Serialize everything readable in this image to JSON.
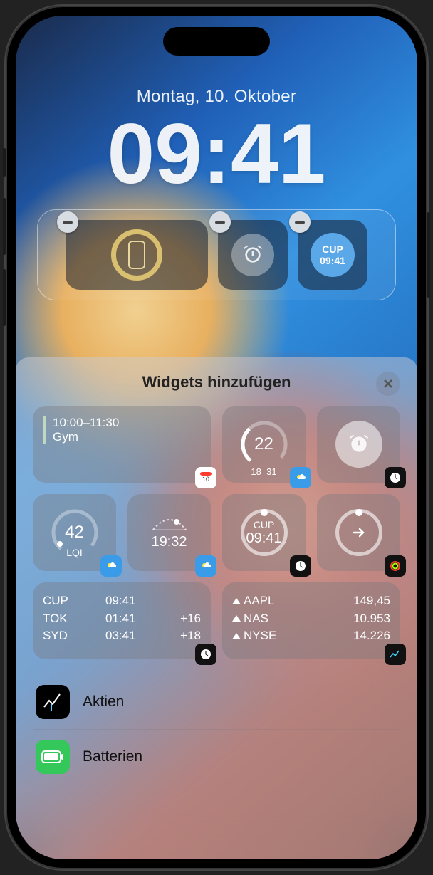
{
  "lock": {
    "date": "Montag, 10. Oktober",
    "time": "09:41",
    "slots": {
      "clock_city": "CUP",
      "clock_time": "09:41"
    }
  },
  "panel": {
    "title": "Widgets hinzufügen",
    "suggested": {
      "calendar": {
        "time": "10:00–11:30",
        "title": "Gym"
      },
      "weather_ring": {
        "value": "22",
        "low": "18",
        "high": "31"
      },
      "aqi": {
        "value": "42",
        "label": "LQI"
      },
      "sunset": {
        "time": "19:32"
      },
      "cup_clock": {
        "label": "CUP",
        "time": "09:41"
      },
      "world_clock": [
        {
          "city": "CUP",
          "time": "09:41",
          "offset": ""
        },
        {
          "city": "TOK",
          "time": "01:41",
          "offset": "+16"
        },
        {
          "city": "SYD",
          "time": "03:41",
          "offset": "+18"
        }
      ],
      "stocks": [
        {
          "sym": "AAPL",
          "val": "149,45"
        },
        {
          "sym": "NAS",
          "val": "10.953"
        },
        {
          "sym": "NYSE",
          "val": "14.226"
        }
      ]
    },
    "apps": {
      "stocks": "Aktien",
      "batteries": "Batterien"
    }
  }
}
